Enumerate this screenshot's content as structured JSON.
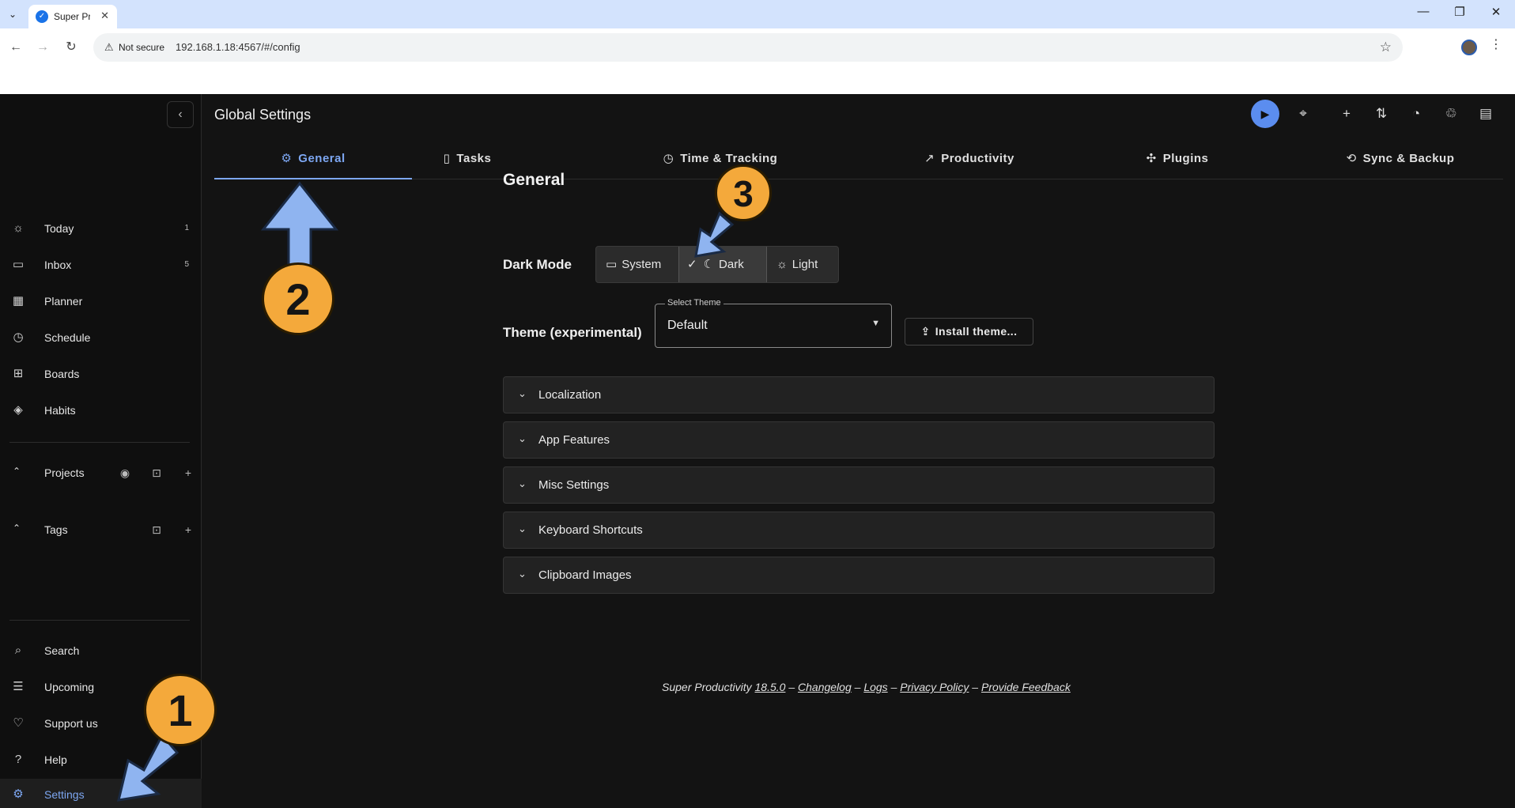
{
  "browser": {
    "tab_title": "Super Pr",
    "not_secure": "Not secure",
    "url": "192.168.1.18:4567/#/config"
  },
  "sidebar": {
    "items": [
      {
        "label": "Today",
        "count": "1",
        "icon": "sun-icon"
      },
      {
        "label": "Inbox",
        "count": "5",
        "icon": "inbox-icon"
      },
      {
        "label": "Planner",
        "count": "",
        "icon": "calendar-edit-icon"
      },
      {
        "label": "Schedule",
        "count": "",
        "icon": "clock-icon"
      },
      {
        "label": "Boards",
        "count": "",
        "icon": "grid-icon"
      },
      {
        "label": "Habits",
        "count": "",
        "icon": "habit-icon"
      }
    ],
    "projects_label": "Projects",
    "tags_label": "Tags",
    "bottom": [
      {
        "label": "Search",
        "icon": "search-icon"
      },
      {
        "label": "Upcoming",
        "icon": "list-icon"
      },
      {
        "label": "Support us",
        "icon": "heart-icon"
      },
      {
        "label": "Help",
        "icon": "help-icon"
      },
      {
        "label": "Settings",
        "icon": "gear-icon"
      }
    ]
  },
  "header": {
    "title": "Global Settings"
  },
  "tabs": [
    {
      "label": "General",
      "icon": "gear-icon"
    },
    {
      "label": "Tasks",
      "icon": "task-icon"
    },
    {
      "label": "Time & Tracking",
      "icon": "timer-icon"
    },
    {
      "label": "Productivity",
      "icon": "trend-icon"
    },
    {
      "label": "Plugins",
      "icon": "puzzle-icon"
    },
    {
      "label": "Sync & Backup",
      "icon": "sync-icon"
    }
  ],
  "general": {
    "title": "General",
    "dark_mode_label": "Dark Mode",
    "dark_mode_options": [
      "System",
      "Dark",
      "Light"
    ],
    "dark_mode_selected": "Dark",
    "theme_label": "Theme (experimental)",
    "select_theme_label": "Select Theme",
    "select_theme_value": "Default",
    "install_theme": "Install theme...",
    "panels": [
      "Localization",
      "App Features",
      "Misc Settings",
      "Keyboard Shortcuts",
      "Clipboard Images"
    ]
  },
  "footer": {
    "app": "Super Productivity",
    "version": "18.5.0",
    "sep": "–",
    "links": [
      "Changelog",
      "Logs",
      "Privacy Policy",
      "Provide Feedback"
    ]
  },
  "annotations": [
    "1",
    "2",
    "3"
  ],
  "colors": {
    "accent": "#7da7f2",
    "badge": "#f4a93b",
    "arrow": "#8fb4f0"
  }
}
